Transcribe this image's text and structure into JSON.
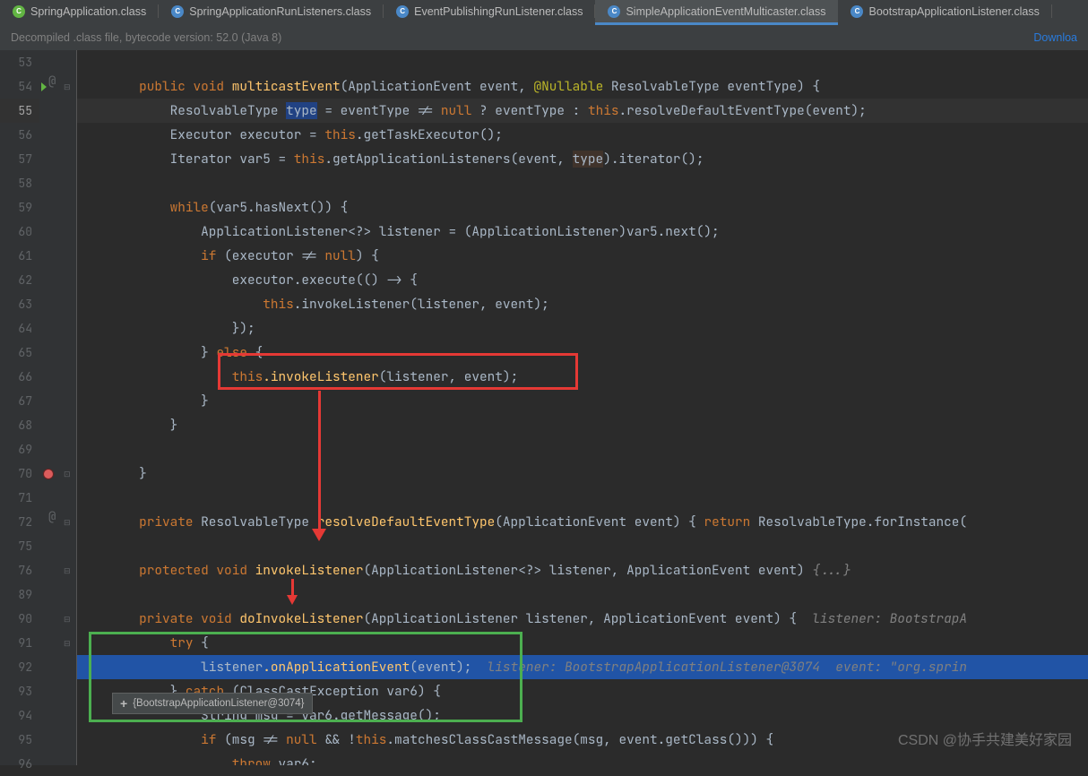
{
  "tabs": [
    {
      "label": "SpringApplication.class",
      "iconClass": "green",
      "active": false
    },
    {
      "label": "SpringApplicationRunListeners.class",
      "iconClass": "",
      "active": false
    },
    {
      "label": "EventPublishingRunListener.class",
      "iconClass": "",
      "active": false
    },
    {
      "label": "SimpleApplicationEventMulticaster.class",
      "iconClass": "",
      "active": true
    },
    {
      "label": "BootstrapApplicationListener.class",
      "iconClass": "",
      "active": false
    }
  ],
  "infobar": {
    "text": "Decompiled .class file, bytecode version: 52.0 (Java 8)",
    "link": "Downloa"
  },
  "line_numbers": [
    "53",
    "54",
    "55",
    "56",
    "57",
    "58",
    "59",
    "60",
    "61",
    "62",
    "63",
    "64",
    "65",
    "66",
    "67",
    "68",
    "69",
    "70",
    "71",
    "72",
    "75",
    "76",
    "89",
    "90",
    "91",
    "92",
    "93",
    "94",
    "95",
    "96"
  ],
  "hl_idx": 2,
  "code": {
    "l54": {
      "indent": "        ",
      "kw1": "public void",
      "method": "multicastEvent",
      "paren1": "(",
      "type1": "ApplicationEvent ",
      "par1": "event",
      "c1": ", ",
      "ann": "@Nullable ",
      "type2": "ResolvableType ",
      "par2": "eventType",
      "tail": ") {"
    },
    "l55": {
      "indent": "            ",
      "type": "ResolvableType ",
      "var": "type",
      "eq": " = ",
      "rhs1": "eventType != ",
      "nul": "null",
      "rhs2": " ? eventType : ",
      "th": "this",
      "rhs3": ".resolveDefaultEventType(event);"
    },
    "l56": {
      "indent": "            ",
      "type": "Executor ",
      "var": "executor = ",
      "th": "this",
      "rhs": ".getTaskExecutor();"
    },
    "l57": {
      "indent": "            ",
      "type": "Iterator ",
      "var": "var5 = ",
      "th": "this",
      "rhs1": ".getApplicationListeners(event, ",
      "u": "type",
      "rhs2": ").iterator();"
    },
    "l59": {
      "indent": "            ",
      "kw": "while",
      "rhs": "(var5.hasNext()) {"
    },
    "l60": {
      "indent": "                ",
      "t1": "ApplicationListener<?> listener = (ApplicationListener)var5.next();"
    },
    "l61": {
      "indent": "                ",
      "kw": "if ",
      "c1": "(executor != ",
      "nul": "null",
      "c2": ") {"
    },
    "l62": {
      "indent": "                    ",
      "t": "executor.execute(() -> {"
    },
    "l63": {
      "indent": "                        ",
      "th": "this",
      "t": ".invokeListener(listener, event);"
    },
    "l64": {
      "indent": "                    ",
      "t": "});"
    },
    "l65": {
      "indent": "                ",
      "t1": "} ",
      "kw": "else",
      "t2": " {"
    },
    "l66": {
      "indent": "                    ",
      "th": "this",
      "m": ".invokeListener",
      "t": "(listener, event);"
    },
    "l67": {
      "indent": "                ",
      "t": "}"
    },
    "l68": {
      "indent": "            ",
      "t": "}"
    },
    "l70": {
      "indent": "        ",
      "t": "}"
    },
    "l72": {
      "indent": "        ",
      "kw": "private ",
      "t1": "ResolvableType ",
      "mth": "resolveDefaultEventType",
      "t2": "(ApplicationEvent event) ",
      "b1": "{ ",
      "kw2": "return ",
      "t3": "ResolvableType.forInstance("
    },
    "l76": {
      "indent": "        ",
      "kw": "protected void ",
      "mth": "invokeListener",
      "t1": "(ApplicationListener<?> listener, ApplicationEvent event) ",
      "fold": "{...}"
    },
    "l90": {
      "indent": "        ",
      "kw": "private void ",
      "mth": "doInvokeListener",
      "t1": "(ApplicationListener listener, ApplicationEvent event) {  ",
      "cmt": "listener: BootstrapA"
    },
    "l91": {
      "indent": "            ",
      "kw": "try ",
      "t": "{"
    },
    "l92": {
      "indent": "                ",
      "t1": "listener",
      "m": ".onApplicationEvent",
      "t2": "(event);  ",
      "cmt": "listener: BootstrapApplicationListener@3074  event: \"org.sprin"
    },
    "l93": {
      "indent": "            ",
      "t1": "} ",
      "kw": "catch ",
      "t2": "(ClassCastException var6) {"
    },
    "l94": {
      "indent": "                ",
      "t1": "String msg = var6.getMessage();"
    },
    "l95": {
      "indent": "                ",
      "kw": "if ",
      "t1": "(msg != ",
      "nul1": "null ",
      "op": "&& !",
      "th": "this",
      "t2": ".matchesClassCastMessage(msg, event.getClass())) {"
    },
    "l96": {
      "indent": "                    ",
      "kw": "throw ",
      "t": "var6;"
    }
  },
  "popup": {
    "text": "{BootstrapApplicationListener@3074}"
  },
  "watermark": "CSDN @协手共建美好家园"
}
